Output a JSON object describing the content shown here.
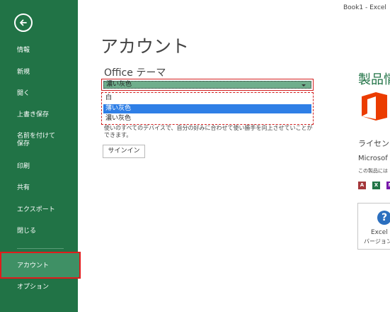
{
  "window": {
    "title": "Book1 - Excel"
  },
  "sidebar": {
    "items": [
      {
        "label": "情報"
      },
      {
        "label": "新規"
      },
      {
        "label": "開く"
      },
      {
        "label": "上書き保存"
      },
      {
        "label": "名前を付けて\n保存"
      },
      {
        "label": "印刷"
      },
      {
        "label": "共有"
      },
      {
        "label": "エクスポート"
      },
      {
        "label": "閉じる"
      },
      {
        "label": "アカウント",
        "active": true
      },
      {
        "label": "オプション"
      }
    ]
  },
  "main": {
    "title": "アカウント",
    "theme": {
      "label": "Office テーマ",
      "selected": "濃い灰色",
      "options": [
        {
          "label": "白",
          "selected": false
        },
        {
          "label": "薄い灰色",
          "selected": true
        },
        {
          "label": "濃い灰色",
          "selected": false
        }
      ]
    },
    "body_text": "使いのすべてのデバイスで、自分の好みに合わせて使い勝手を向上させていことができます。",
    "signin_label": "サインイン"
  },
  "product": {
    "title": "製品情",
    "license_title": "ライセン",
    "license_product": "Microsof",
    "license_note": "この製品には",
    "app_icons": [
      {
        "name": "access-icon",
        "letter": "A",
        "color": "#a4373a"
      },
      {
        "name": "excel-icon",
        "letter": "X",
        "color": "#217346"
      },
      {
        "name": "onenote-icon",
        "letter": "N",
        "color": "#7719aa"
      }
    ],
    "about": {
      "line1": "Excel",
      "line2": "バージョン"
    }
  },
  "colors": {
    "sidebar": "#217346",
    "sidebar_active": "#3f9065",
    "selection": "#2f7fe6",
    "highlight_border": "#d21f1f",
    "office_logo": "#eb3c00"
  }
}
